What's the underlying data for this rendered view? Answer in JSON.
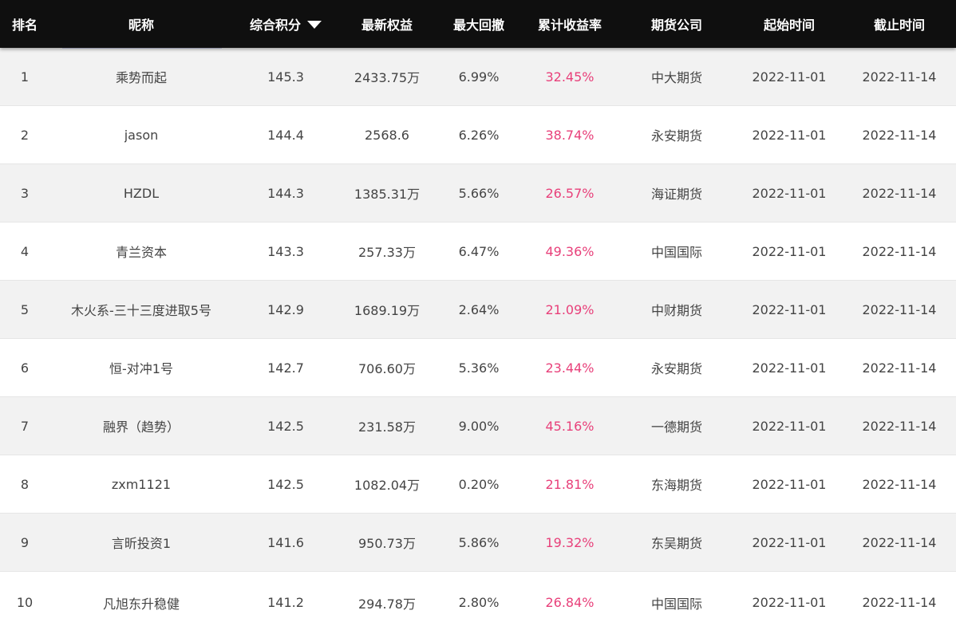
{
  "header": {
    "rank": "排名",
    "nickname": "昵称",
    "score": "综合积分",
    "equity": "最新权益",
    "drawdown": "最大回撤",
    "return": "累计收益率",
    "company": "期货公司",
    "start": "起始时间",
    "end": "截止时间"
  },
  "colors": {
    "header_bg": "#0f0f0f",
    "row_alt_bg": "#f2f2f2",
    "return_color": "#e8407a",
    "text_color": "#444444"
  },
  "rows": [
    {
      "rank": "1",
      "name": "乘势而起",
      "score": "145.3",
      "equity": "2433.75万",
      "drawdown": "6.99%",
      "ret": "32.45%",
      "company": "中大期货",
      "start": "2022-11-01",
      "end": "2022-11-14"
    },
    {
      "rank": "2",
      "name": "jason",
      "score": "144.4",
      "equity": "2568.6",
      "drawdown": "6.26%",
      "ret": "38.74%",
      "company": "永安期货",
      "start": "2022-11-01",
      "end": "2022-11-14"
    },
    {
      "rank": "3",
      "name": "HZDL",
      "score": "144.3",
      "equity": "1385.31万",
      "drawdown": "5.66%",
      "ret": "26.57%",
      "company": "海证期货",
      "start": "2022-11-01",
      "end": "2022-11-14"
    },
    {
      "rank": "4",
      "name": "青兰资本",
      "score": "143.3",
      "equity": "257.33万",
      "drawdown": "6.47%",
      "ret": "49.36%",
      "company": "中国国际",
      "start": "2022-11-01",
      "end": "2022-11-14"
    },
    {
      "rank": "5",
      "name": "木火系-三十三度进取5号",
      "score": "142.9",
      "equity": "1689.19万",
      "drawdown": "2.64%",
      "ret": "21.09%",
      "company": "中财期货",
      "start": "2022-11-01",
      "end": "2022-11-14"
    },
    {
      "rank": "6",
      "name": "恒-对冲1号",
      "score": "142.7",
      "equity": "706.60万",
      "drawdown": "5.36%",
      "ret": "23.44%",
      "company": "永安期货",
      "start": "2022-11-01",
      "end": "2022-11-14"
    },
    {
      "rank": "7",
      "name": "融界（趋势）",
      "score": "142.5",
      "equity": "231.58万",
      "drawdown": "9.00%",
      "ret": "45.16%",
      "company": "一德期货",
      "start": "2022-11-01",
      "end": "2022-11-14"
    },
    {
      "rank": "8",
      "name": "zxm1121",
      "score": "142.5",
      "equity": "1082.04万",
      "drawdown": "0.20%",
      "ret": "21.81%",
      "company": "东海期货",
      "start": "2022-11-01",
      "end": "2022-11-14"
    },
    {
      "rank": "9",
      "name": "言昕投资1",
      "score": "141.6",
      "equity": "950.73万",
      "drawdown": "5.86%",
      "ret": "19.32%",
      "company": "东吴期货",
      "start": "2022-11-01",
      "end": "2022-11-14"
    },
    {
      "rank": "10",
      "name": "凡旭东升稳健",
      "score": "141.2",
      "equity": "294.78万",
      "drawdown": "2.80%",
      "ret": "26.84%",
      "company": "中国国际",
      "start": "2022-11-01",
      "end": "2022-11-14"
    }
  ]
}
